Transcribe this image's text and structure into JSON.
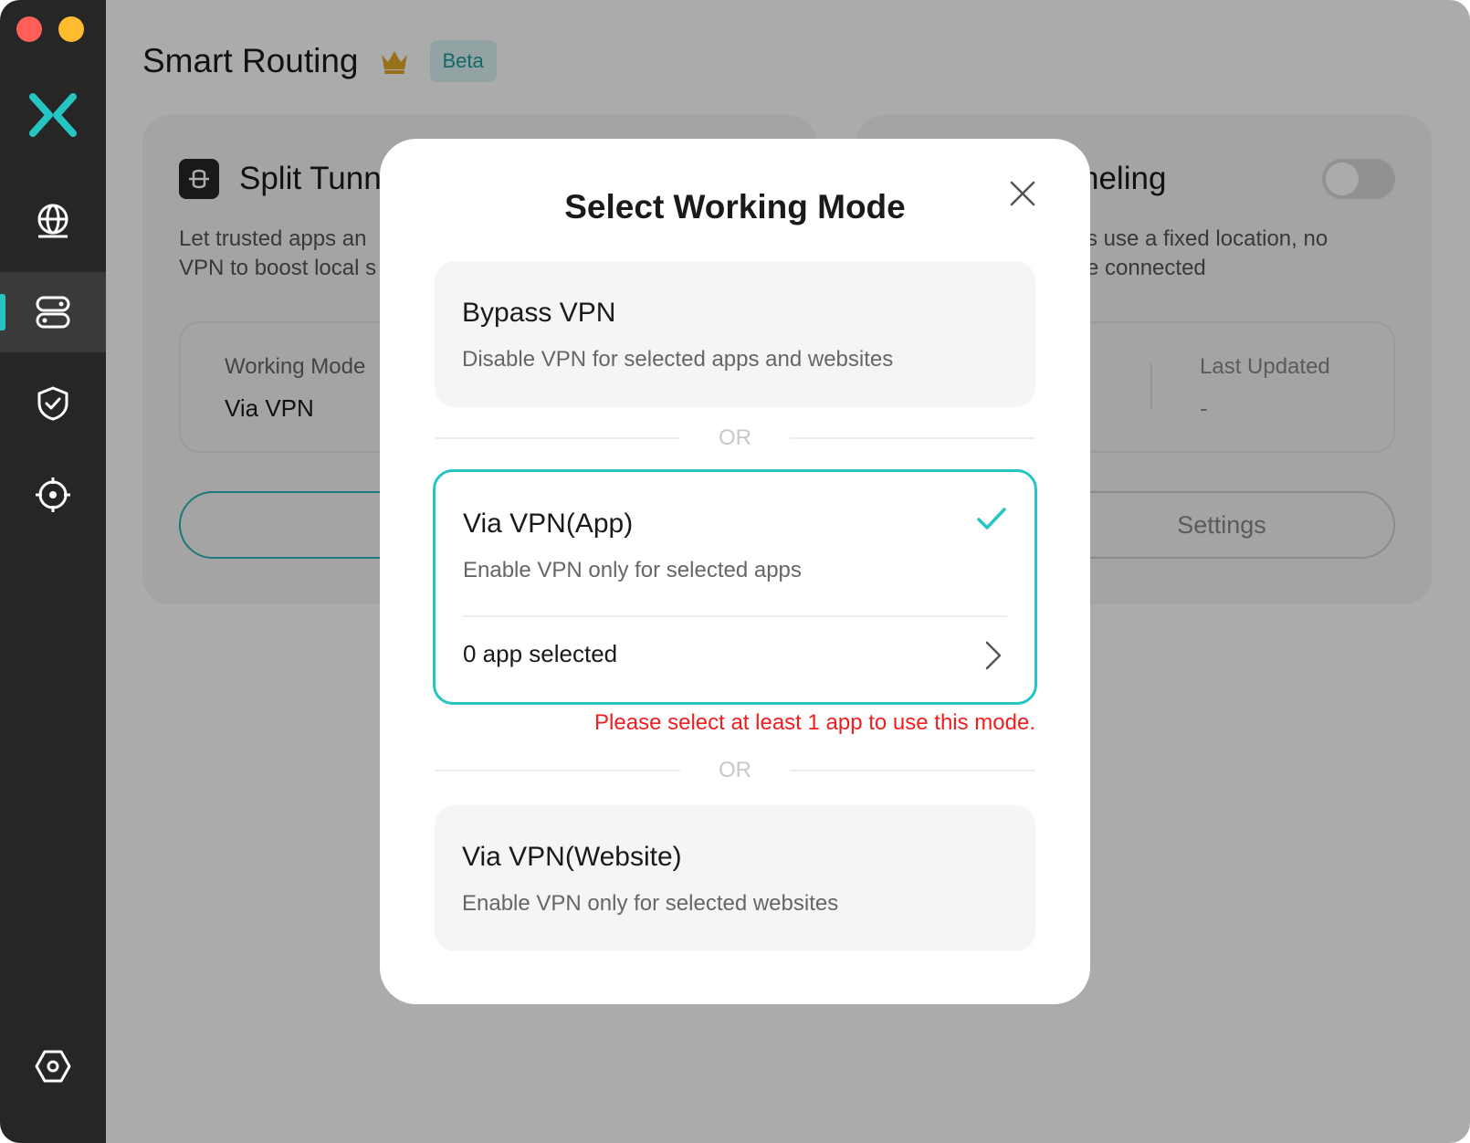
{
  "sidebar": {
    "nav_items": [
      "globe-icon",
      "routing-icon",
      "shield-check-icon",
      "crosshair-icon"
    ],
    "settings_icon": "settings-hex-icon",
    "accent_color": "#27c4c4"
  },
  "header": {
    "title": "Smart Routing",
    "badge": "Beta"
  },
  "left_card": {
    "title": "Split Tunn",
    "desc_line1": "Let trusted apps an",
    "desc_line2": "VPN to boost local s",
    "working_mode_label": "Working Mode",
    "working_mode_value": "Via VPN"
  },
  "right_card": {
    "title": "neling",
    "desc_line1": "s use a fixed location, no",
    "desc_line2": "e connected",
    "last_updated_label": "Last Updated",
    "last_updated_value": "-",
    "settings_button": "Settings",
    "toggle_on": false
  },
  "modal": {
    "title": "Select Working Mode",
    "or_text": "OR",
    "options": [
      {
        "title": "Bypass VPN",
        "desc": "Disable VPN for selected apps and websites",
        "selected": false
      },
      {
        "title": "Via VPN(App)",
        "desc": "Enable VPN only for selected apps",
        "selected": true,
        "apps_selected": "0 app selected"
      },
      {
        "title": "Via VPN(Website)",
        "desc": "Enable VPN only for selected websites",
        "selected": false
      }
    ],
    "error": "Please select at least 1 app to use this mode.",
    "error_color": "#f01e1e"
  }
}
